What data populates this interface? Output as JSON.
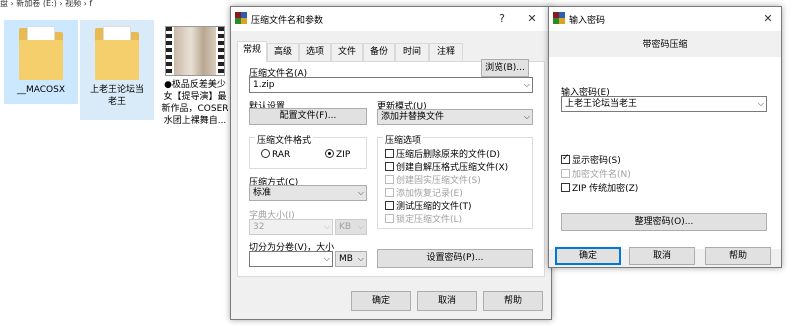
{
  "explorer": {
    "breadcrumb": "盘 › 新加卷 (E:) › 视频 › f",
    "files": [
      {
        "name": "__MACOSX",
        "type": "folder"
      },
      {
        "name": "上老王论坛当老王",
        "type": "folder"
      },
      {
        "name": "●极品反差美少女【提导演】最新作品，COSER水团上裸舞自...",
        "type": "video"
      }
    ]
  },
  "archive_dialog": {
    "title": "压缩文件名和参数",
    "help_icon": "?",
    "close_icon": "✕",
    "tabs": [
      "常规",
      "高级",
      "选项",
      "文件",
      "备份",
      "时间",
      "注释"
    ],
    "active_tab": 0,
    "archive_name_label": "压缩文件名(A)",
    "browse_button": "浏览(B)...",
    "archive_name_value": "1.zip",
    "default_settings_label": "默认设置",
    "profiles_button": "配置文件(F)...",
    "update_mode_label": "更新模式(U)",
    "update_mode_value": "添加并替换文件",
    "format_group_label": "压缩文件格式",
    "format_rar": "RAR",
    "format_zip": "ZIP",
    "selected_format": "ZIP",
    "method_label": "压缩方式(C)",
    "method_value": "标准",
    "dict_label": "字典大小(I)",
    "dict_value": "32",
    "dict_unit": "KB",
    "split_label": "切分为分卷(V)，大小",
    "split_value": "",
    "split_unit": "MB",
    "set_password_button": "设置密码(P)...",
    "options_group_label": "压缩选项",
    "options": [
      {
        "label": "压缩后删除原来的文件(D)",
        "checked": false,
        "disabled": false
      },
      {
        "label": "创建自解压格式压缩文件(X)",
        "checked": false,
        "disabled": false
      },
      {
        "label": "创建固实压缩文件(S)",
        "checked": false,
        "disabled": true
      },
      {
        "label": "添加恢复记录(E)",
        "checked": false,
        "disabled": true
      },
      {
        "label": "测试压缩的文件(T)",
        "checked": false,
        "disabled": false
      },
      {
        "label": "锁定压缩文件(L)",
        "checked": false,
        "disabled": true
      }
    ],
    "ok_button": "确定",
    "cancel_button": "取消",
    "help_button": "帮助"
  },
  "password_dialog": {
    "title": "输入密码",
    "close_icon": "✕",
    "subtitle": "带密码压缩",
    "password_label": "输入密码(E)",
    "password_value": "上老王论坛当老王",
    "show_password": "显示密码(S)",
    "show_password_checked": true,
    "encrypt_names": "加密文件名(N)",
    "encrypt_names_checked": false,
    "zip_legacy": "ZIP 传统加密(Z)",
    "zip_legacy_checked": false,
    "organize_button": "整理密码(O)...",
    "ok_button": "确定",
    "cancel_button": "取消",
    "help_button": "帮助"
  }
}
